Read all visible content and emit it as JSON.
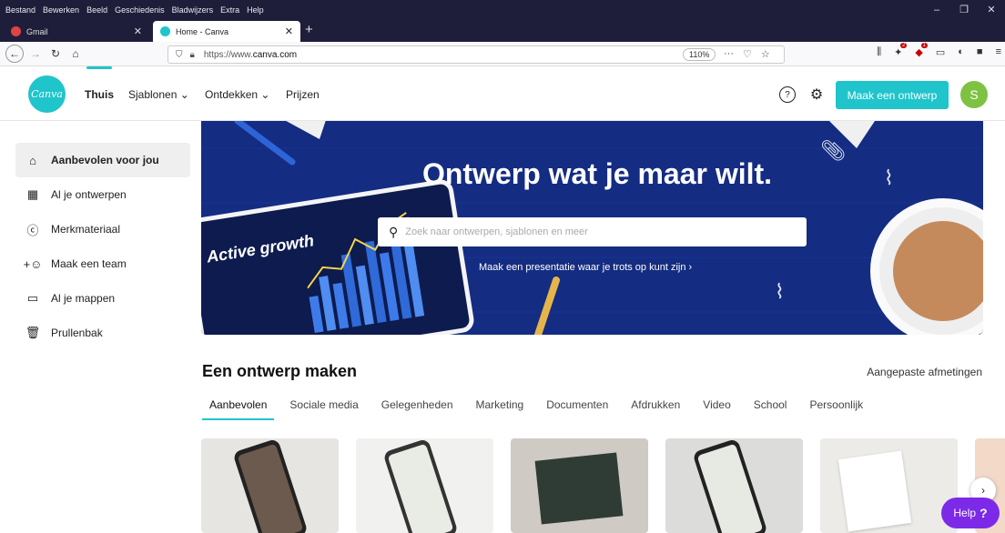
{
  "browser": {
    "menu": [
      "Bestand",
      "Bewerken",
      "Beeld",
      "Geschiedenis",
      "Bladwijzers",
      "Extra",
      "Help"
    ],
    "tabs": [
      {
        "label": "Gmail",
        "icon": "gmail-icon"
      },
      {
        "label": "Home - Canva",
        "icon": "canva-icon"
      }
    ],
    "url_prefix": "https://www.",
    "url_domain": "canva.com",
    "zoom": "110%"
  },
  "header": {
    "logo_text": "Canva",
    "nav": [
      "Thuis",
      "Sjablonen ⌄",
      "Ontdekken ⌄",
      "Prijzen"
    ],
    "cta": "Maak een ontwerp",
    "avatar_letter": "S",
    "help_icon": "?",
    "settings_icon": "⚙"
  },
  "sidebar": {
    "items": [
      {
        "label": "Aanbevolen voor jou",
        "icon": "home-icon"
      },
      {
        "label": "Al je ontwerpen",
        "icon": "grid-icon"
      },
      {
        "label": "Merkmateriaal",
        "icon": "brand-icon"
      },
      {
        "label": "Maak een team",
        "icon": "add-team-icon"
      },
      {
        "label": "Al je mappen",
        "icon": "folder-icon"
      },
      {
        "label": "Prullenbak",
        "icon": "trash-icon"
      }
    ]
  },
  "hero": {
    "title": "Ontwerp wat je maar wilt.",
    "search_placeholder": "Zoek naar ontwerpen, sjablonen en meer",
    "link": "Maak een presentatie waar je trots op kunt zijn ›",
    "tablet_text": "Active growth"
  },
  "create": {
    "title": "Een ontwerp maken",
    "custom_size": "Aangepaste afmetingen",
    "categories": [
      "Aanbevolen",
      "Sociale media",
      "Gelegenheden",
      "Marketing",
      "Documenten",
      "Afdrukken",
      "Video",
      "School",
      "Persoonlijk"
    ]
  },
  "help_button": {
    "label": "Help",
    "mark": "?"
  },
  "colors": {
    "accent": "#20c4cb",
    "hero_bg": "#142c82",
    "help": "#7d2ae8",
    "avatar": "#7dc242"
  }
}
